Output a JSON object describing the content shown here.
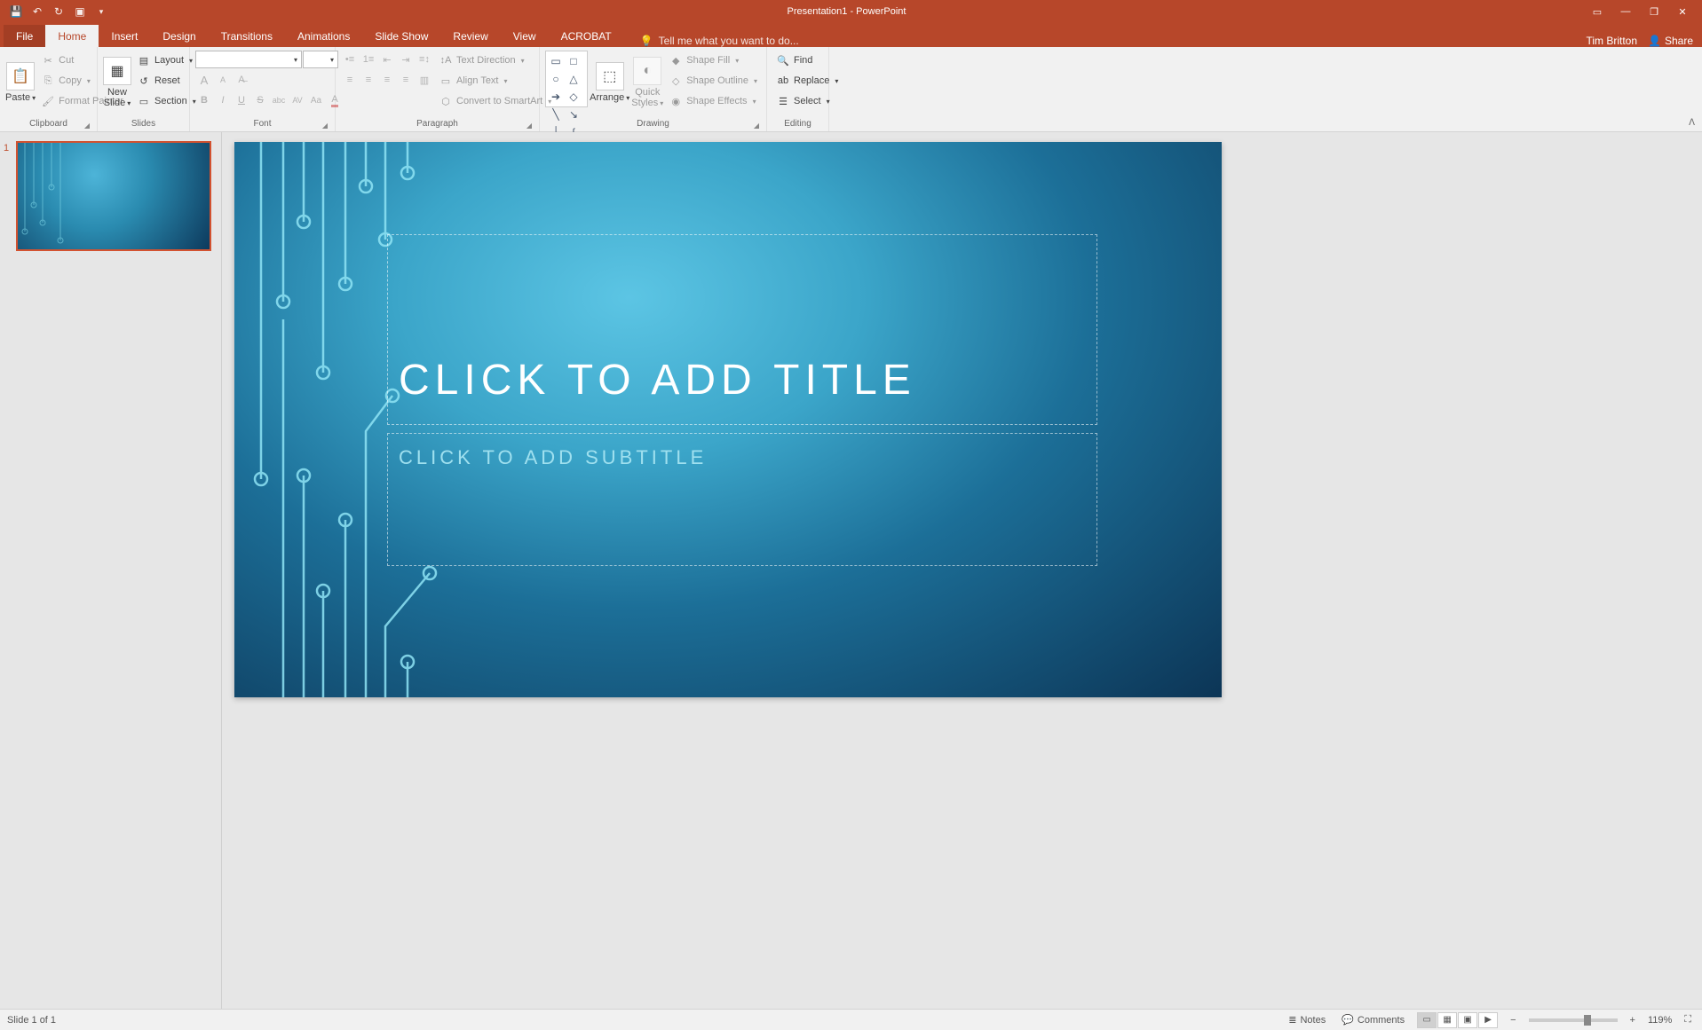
{
  "titlebar": {
    "title": "Presentation1 - PowerPoint"
  },
  "qat": {
    "save": "save",
    "undo": "undo",
    "redo": "redo",
    "start": "start-from-beginning",
    "customize": "customize-qat"
  },
  "win": {
    "ribbon_opts": "ribbon-display-options",
    "min": "minimize",
    "max": "restore",
    "close": "close"
  },
  "tabs": {
    "file": "File",
    "home": "Home",
    "insert": "Insert",
    "design": "Design",
    "transitions": "Transitions",
    "animations": "Animations",
    "slideshow": "Slide Show",
    "review": "Review",
    "view": "View",
    "acrobat": "ACROBAT"
  },
  "tellme": "Tell me what you want to do...",
  "account": {
    "user": "Tim Britton",
    "share": "Share"
  },
  "ribbon": {
    "clipboard": {
      "label": "Clipboard",
      "paste": "Paste",
      "cut": "Cut",
      "copy": "Copy",
      "painter": "Format Painter"
    },
    "slides": {
      "label": "Slides",
      "newslide": "New\nSlide",
      "layout": "Layout",
      "reset": "Reset",
      "section": "Section"
    },
    "font": {
      "label": "Font",
      "increase": "A",
      "decrease": "A",
      "clear": "Aᵥ",
      "b": "B",
      "i": "I",
      "u": "U",
      "s": "S",
      "shadow": "abc",
      "spacing": "AV",
      "case": "Aa",
      "color": "A"
    },
    "paragraph": {
      "label": "Paragraph",
      "direction": "Text Direction",
      "align": "Align Text",
      "smartart": "Convert to SmartArt"
    },
    "drawing": {
      "label": "Drawing",
      "arrange": "Arrange",
      "quick": "Quick\nStyles",
      "fill": "Shape Fill",
      "outline": "Shape Outline",
      "effects": "Shape Effects"
    },
    "editing": {
      "label": "Editing",
      "find": "Find",
      "replace": "Replace",
      "select": "Select"
    }
  },
  "thumb": {
    "num": "1"
  },
  "slide": {
    "title_placeholder": "CLICK TO ADD TITLE",
    "subtitle_placeholder": "CLICK TO ADD SUBTITLE"
  },
  "status": {
    "slide_info": "Slide 1 of 1",
    "notes": "Notes",
    "comments": "Comments",
    "zoom": "119%"
  }
}
